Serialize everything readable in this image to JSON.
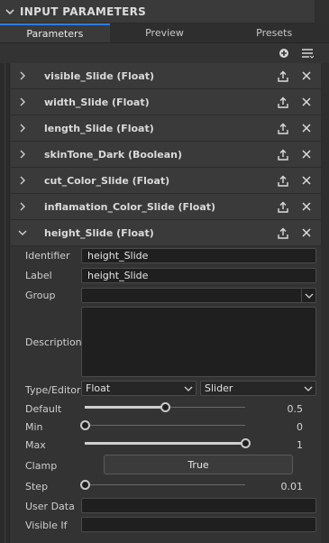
{
  "panel": {
    "title": "INPUT PARAMETERS"
  },
  "tabs": [
    {
      "label": "Parameters",
      "active": true
    },
    {
      "label": "Preview",
      "active": false
    },
    {
      "label": "Presets",
      "active": false
    }
  ],
  "toolbar": {
    "add_icon": "add-circle-icon",
    "menu_icon": "list-menu-icon"
  },
  "parameters": [
    {
      "label": "visible_Slide (Float)",
      "expanded": false
    },
    {
      "label": "width_Slide (Float)",
      "expanded": false
    },
    {
      "label": "length_Slide (Float)",
      "expanded": false
    },
    {
      "label": "skinTone_Dark (Boolean)",
      "expanded": false
    },
    {
      "label": "cut_Color_Slide (Float)",
      "expanded": false
    },
    {
      "label": "inflamation_Color_Slide (Float)",
      "expanded": false
    },
    {
      "label": "height_Slide (Float)",
      "expanded": true
    }
  ],
  "properties": {
    "identifier": {
      "label": "Identifier",
      "value": "height_Slide"
    },
    "label_field": {
      "label": "Label",
      "value": "height_Slide"
    },
    "group": {
      "label": "Group",
      "value": ""
    },
    "description": {
      "label": "Description",
      "value": ""
    },
    "type_editor": {
      "label": "Type/Editor",
      "type": "Float",
      "editor": "Slider"
    },
    "default": {
      "label": "Default",
      "value": "0.5",
      "fraction": 0.5
    },
    "min": {
      "label": "Min",
      "value": "0",
      "fraction": 0.0
    },
    "max": {
      "label": "Max",
      "value": "1",
      "fraction": 1.0
    },
    "clamp": {
      "label": "Clamp",
      "value": "True"
    },
    "step": {
      "label": "Step",
      "value": "0.01",
      "fraction": 0.0
    },
    "user_data": {
      "label": "User Data",
      "value": ""
    },
    "visible_if": {
      "label": "Visible If",
      "value": ""
    }
  },
  "colors": {
    "accent": "#2f7de1",
    "panel_bg": "#333333",
    "row_bg": "#3a3a3a",
    "field_bg": "#1f1f1f"
  }
}
